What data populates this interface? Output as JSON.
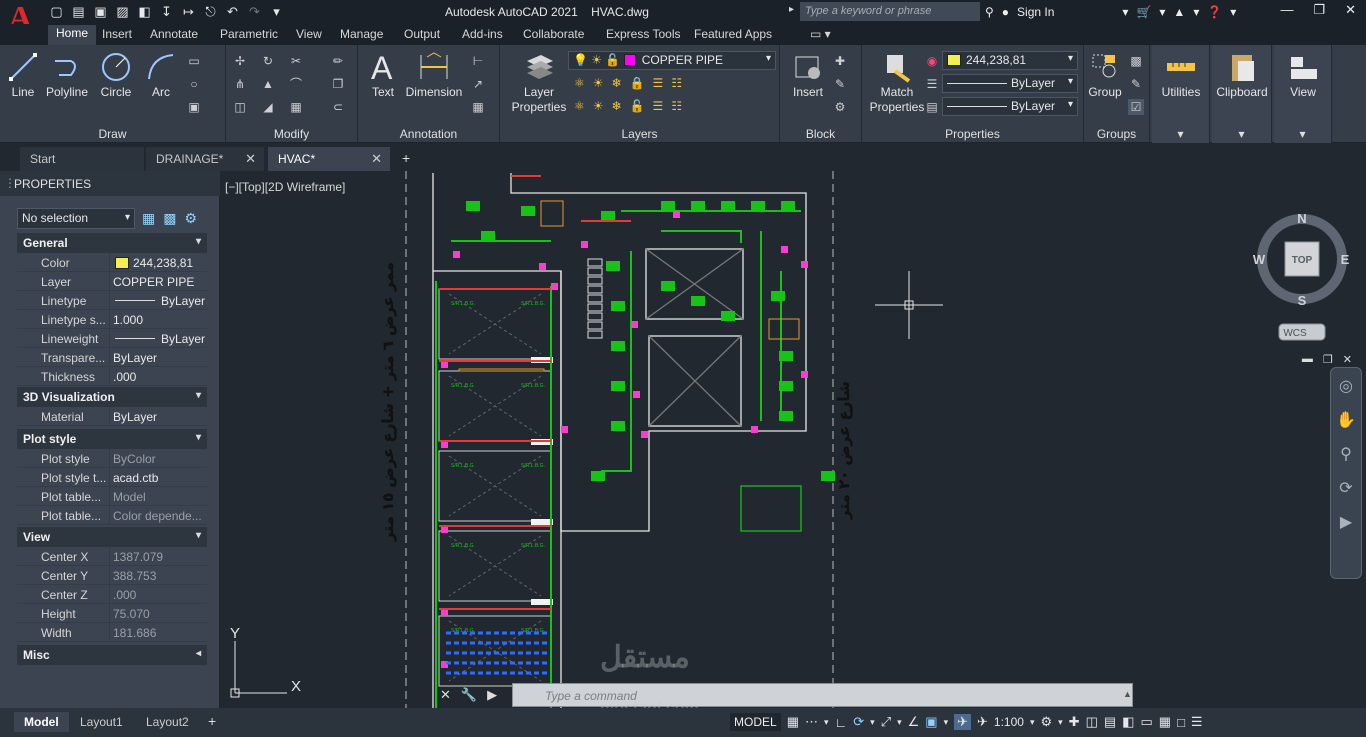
{
  "app": {
    "logo": "A",
    "title": "Autodesk AutoCAD 2021    HVAC.dwg",
    "search_placeholder": "Type a keyword or phrase",
    "sign_in": "Sign In"
  },
  "ribbon_tabs": [
    "Home",
    "Insert",
    "Annotate",
    "Parametric",
    "View",
    "Manage",
    "Output",
    "Add-ins",
    "Collaborate",
    "Express Tools",
    "Featured Apps"
  ],
  "ribbon": {
    "draw": {
      "title": "Draw",
      "line": "Line",
      "polyline": "Polyline",
      "circle": "Circle",
      "arc": "Arc"
    },
    "modify": {
      "title": "Modify"
    },
    "annotation": {
      "title": "Annotation",
      "text": "Text",
      "dimension": "Dimension"
    },
    "layers": {
      "title": "Layers",
      "layer_properties": "Layer\nProperties",
      "current_layer": "COPPER PIPE"
    },
    "block": {
      "title": "Block",
      "insert": "Insert"
    },
    "properties": {
      "title": "Properties",
      "match": "Match\nProperties",
      "color": "244,238,81",
      "linetype": "ByLayer",
      "lineweight": "ByLayer"
    },
    "groups": {
      "title": "Groups",
      "group": "Group"
    },
    "utilities": "Utilities",
    "clipboard": "Clipboard",
    "view": "View"
  },
  "doc_tabs": [
    {
      "label": "Start"
    },
    {
      "label": "DRAINAGE*"
    },
    {
      "label": "HVAC*"
    }
  ],
  "properties_panel": {
    "title": "PROPERTIES",
    "selection": "No selection",
    "sections": {
      "general": "General",
      "visualization": "3D Visualization",
      "plot": "Plot style",
      "view": "View",
      "misc": "Misc"
    },
    "general": [
      {
        "k": "Color",
        "v": "244,238,81"
      },
      {
        "k": "Layer",
        "v": "COPPER PIPE"
      },
      {
        "k": "Linetype",
        "v": "ByLayer"
      },
      {
        "k": "Linetype s...",
        "v": "1.000"
      },
      {
        "k": "Lineweight",
        "v": "ByLayer"
      },
      {
        "k": "Transpare...",
        "v": "ByLayer"
      },
      {
        "k": "Thickness",
        "v": ".000"
      }
    ],
    "visualization": [
      {
        "k": "Material",
        "v": "ByLayer"
      }
    ],
    "plot": [
      {
        "k": "Plot style",
        "v": "ByColor"
      },
      {
        "k": "Plot style t...",
        "v": "acad.ctb"
      },
      {
        "k": "Plot table...",
        "v": "Model"
      },
      {
        "k": "Plot table...",
        "v": "Color depende..."
      }
    ],
    "view": [
      {
        "k": "Center X",
        "v": "1387.079"
      },
      {
        "k": "Center Y",
        "v": "388.753"
      },
      {
        "k": "Center Z",
        "v": ".000"
      },
      {
        "k": "Height",
        "v": "75.070"
      },
      {
        "k": "Width",
        "v": "181.686"
      }
    ]
  },
  "viewport": {
    "label": "[−][Top][2D Wireframe]",
    "viewcube": {
      "n": "N",
      "s": "S",
      "e": "E",
      "w": "W",
      "face": "TOP",
      "wcs": "WCS"
    },
    "street_left": "ممر عرض ٦ متر + شارع عرض ١٥ متر",
    "street_right": "شارع عرض ٢٠ متر",
    "ucs_x": "X",
    "ucs_y": "Y",
    "room_label": "S/R.L.B.G.",
    "room_value": "9.0M/²",
    "room_dia": "Ø10\""
  },
  "command": {
    "placeholder": "Type  a  command"
  },
  "layout_tabs": [
    "Model",
    "Layout1",
    "Layout2"
  ],
  "status": {
    "model": "MODEL",
    "scale": "1:100"
  },
  "watermark": {
    "brand": "مستقل",
    "domain": "mostaql.com"
  }
}
